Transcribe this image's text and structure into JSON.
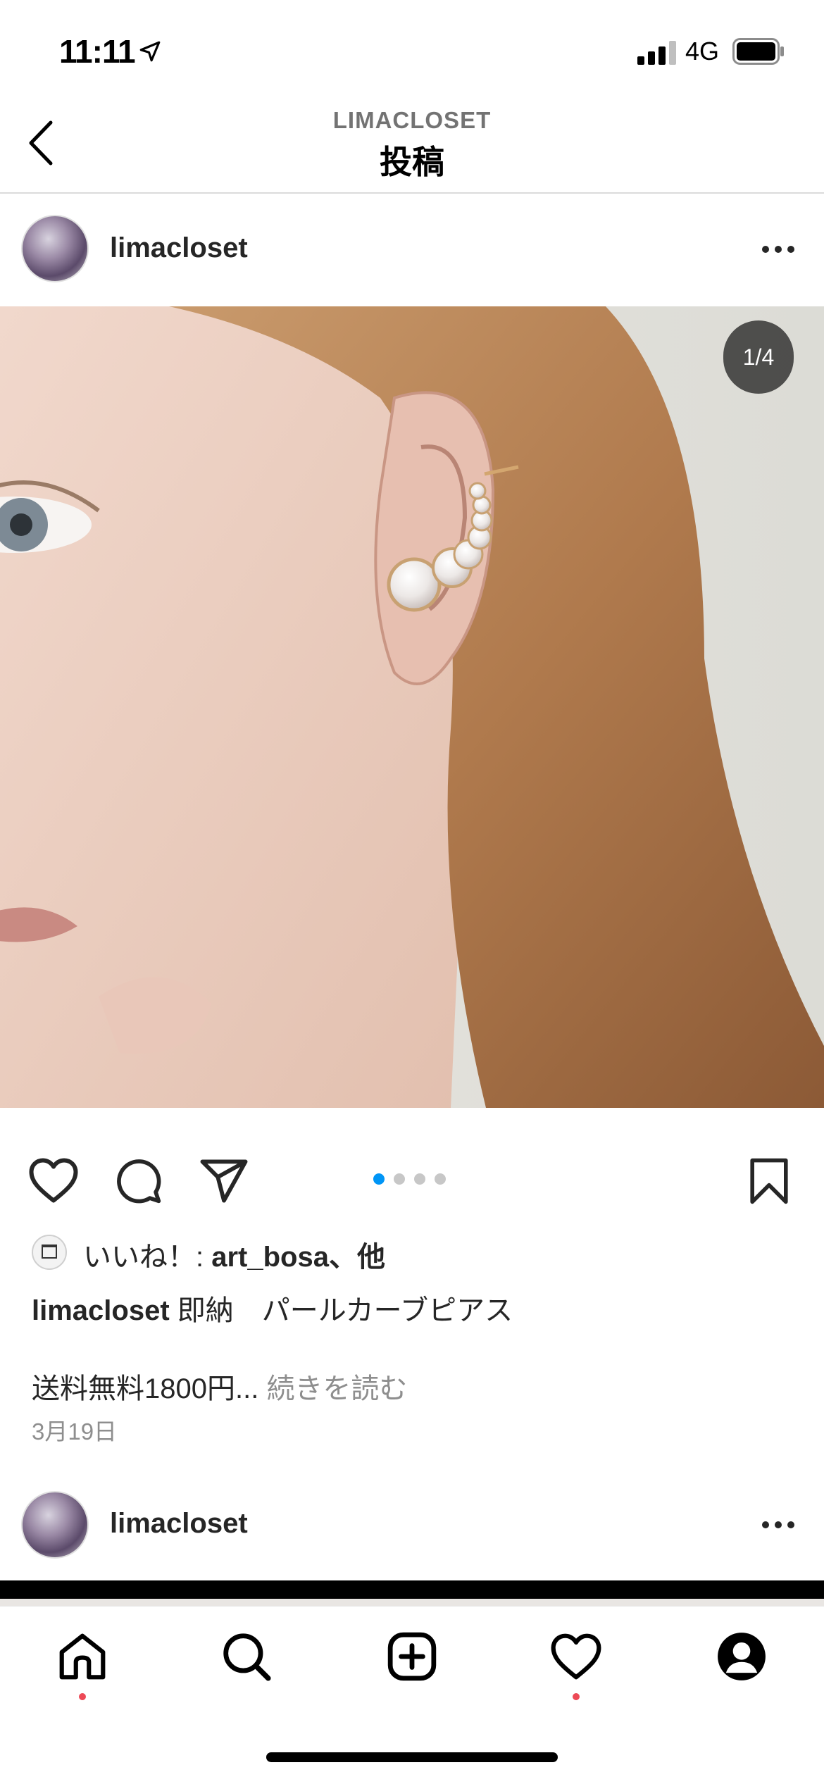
{
  "status_bar": {
    "time": "11:11",
    "network": "4G",
    "icons": [
      "location-arrow-icon",
      "signal-icon",
      "battery-icon"
    ]
  },
  "nav": {
    "back_icon": "chevron-left-icon",
    "account": "LIMACLOSET",
    "title": "投稿"
  },
  "post": {
    "username": "limacloset",
    "more_icon": "more-horizontal-icon",
    "image_counter": "1/4",
    "carousel": {
      "total": 4,
      "active_index": 0,
      "active_color": "#0095f6",
      "inactive_color": "#c7c7c7"
    },
    "actions": [
      "heart-icon",
      "comment-icon",
      "share-icon",
      "bookmark-icon"
    ],
    "likes": {
      "prefix": "いいね！: ",
      "user": "art_bosa",
      "suffix": "、他"
    },
    "caption": {
      "username": "limacloset",
      "text": " 即納　パールカーブピアス"
    },
    "caption_line2": {
      "text": "送料無料1800円... ",
      "more": "続きを読む"
    },
    "date": "3月19日"
  },
  "next_post": {
    "username": "limacloset"
  },
  "tab_bar": {
    "items": [
      {
        "name": "home",
        "icon": "home-icon",
        "badge": true
      },
      {
        "name": "search",
        "icon": "search-icon",
        "badge": false
      },
      {
        "name": "create",
        "icon": "plus-square-icon",
        "badge": false
      },
      {
        "name": "activity",
        "icon": "heart-icon",
        "badge": true
      },
      {
        "name": "profile",
        "icon": "profile-icon",
        "badge": false
      }
    ],
    "badge_color": "#ed4956"
  }
}
